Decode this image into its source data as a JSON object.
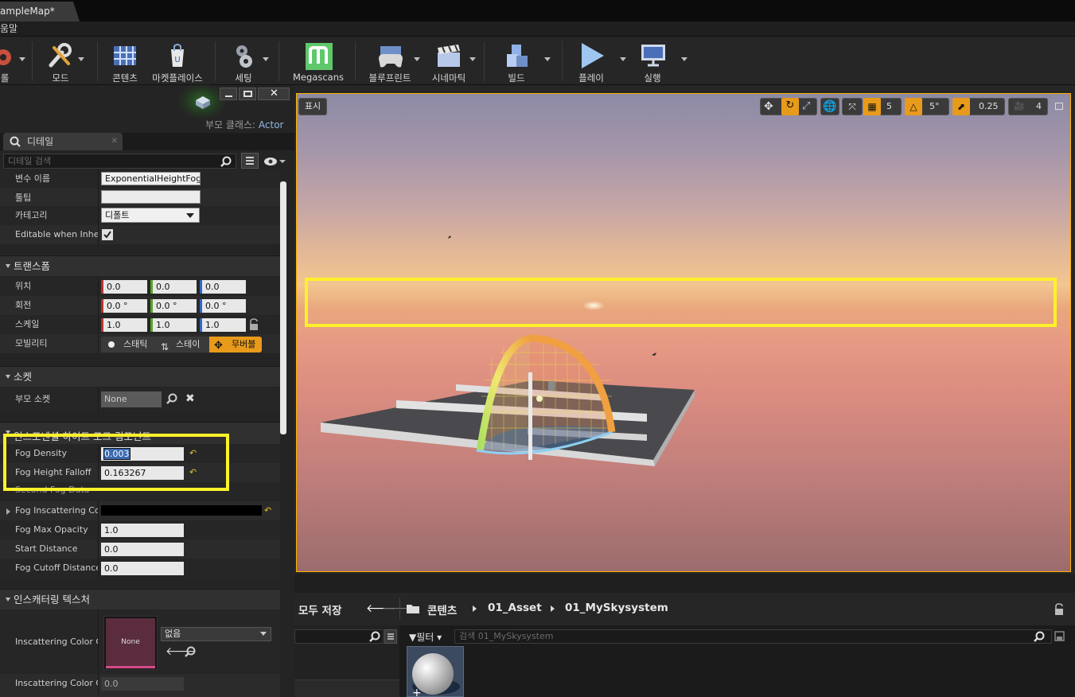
{
  "window": {
    "tab_title": "ampleMap*",
    "menu_item": "움말"
  },
  "toolbar": {
    "items": [
      {
        "label": "롤",
        "icon": "build-icon"
      },
      {
        "label": "모드",
        "icon": "wrench-icon"
      },
      {
        "label": "콘텐츠",
        "icon": "grid-icon"
      },
      {
        "label": "마켓플레이스",
        "icon": "shopping-bag-icon"
      },
      {
        "label": "세팅",
        "icon": "gears-icon"
      },
      {
        "label": "Megascans",
        "icon": "megascans-icon"
      },
      {
        "label": "블루프린트",
        "icon": "gamepad-icon"
      },
      {
        "label": "시네마틱",
        "icon": "clapperboard-icon"
      },
      {
        "label": "빌드",
        "icon": "cubes-icon"
      },
      {
        "label": "플레이",
        "icon": "play-icon"
      },
      {
        "label": "실행",
        "icon": "monitor-icon"
      }
    ],
    "accent": "#5fc86b"
  },
  "details": {
    "parent_class_label": "부모 클래스:",
    "parent_class_value": "Actor",
    "tab_label": "디테일",
    "search_placeholder": "디테일 검색",
    "general": [
      {
        "name": "변수 이름",
        "value": "ExponentialHeightFog"
      },
      {
        "name": "툴팁",
        "value": ""
      },
      {
        "name": "카테고리",
        "value": "디폴트"
      },
      {
        "name": "Editable when Inherit",
        "value": "checked"
      }
    ],
    "transform": {
      "title": "트랜스폼",
      "location": {
        "label": "위치",
        "values": [
          "0.0",
          "0.0",
          "0.0"
        ]
      },
      "rotation": {
        "label": "회전",
        "values": [
          "0.0 °",
          "0.0 °",
          "0.0 °"
        ]
      },
      "scale": {
        "label": "스케일",
        "values": [
          "1.0",
          "1.0",
          "1.0"
        ]
      },
      "mobility": {
        "label": "모빌리티",
        "options": [
          "스태틱",
          "스테이",
          "무버블"
        ],
        "selected": "무버블"
      }
    },
    "socket": {
      "title": "소켓",
      "parent_socket_label": "부모 소켓",
      "parent_socket_value": "None"
    },
    "fog_component": {
      "title": "인스포넨셜 하이트 포그 컴포넌트",
      "fog_density": {
        "label": "Fog Density",
        "value": "0.003"
      },
      "fog_height_falloff": {
        "label": "Fog Height Falloff",
        "value": "0.163267"
      },
      "second_fog_data": "Second Fog Data",
      "fog_inscattering_color": {
        "label": "Fog Inscattering Colo"
      },
      "fog_max_opacity": {
        "label": "Fog Max Opacity",
        "value": "1.0"
      },
      "start_distance": {
        "label": "Start Distance",
        "value": "0.0"
      },
      "fog_cutoff_distance": {
        "label": "Fog Cutoff Distance",
        "value": "0.0"
      }
    },
    "inscattering": {
      "title": "인스캐터링 텍스처",
      "cubemap_label": "Inscattering Color Cu",
      "cubemap_thumb": "None",
      "cubemap_select": "없음",
      "angle_label": "Inscattering Color Cu",
      "angle_value": "0.0"
    }
  },
  "viewport": {
    "show_button": "표시",
    "grid_snap": "5",
    "rotation_snap": "5°",
    "scale_snap": "0.25",
    "camera_speed": "4"
  },
  "content_browser": {
    "save_all": "모두 저장",
    "breadcrumb": [
      "콘텐츠",
      "01_Asset",
      "01_MySkysystem"
    ],
    "filter_label": "필터",
    "search_placeholder": "검색 01_MySkysystem"
  }
}
